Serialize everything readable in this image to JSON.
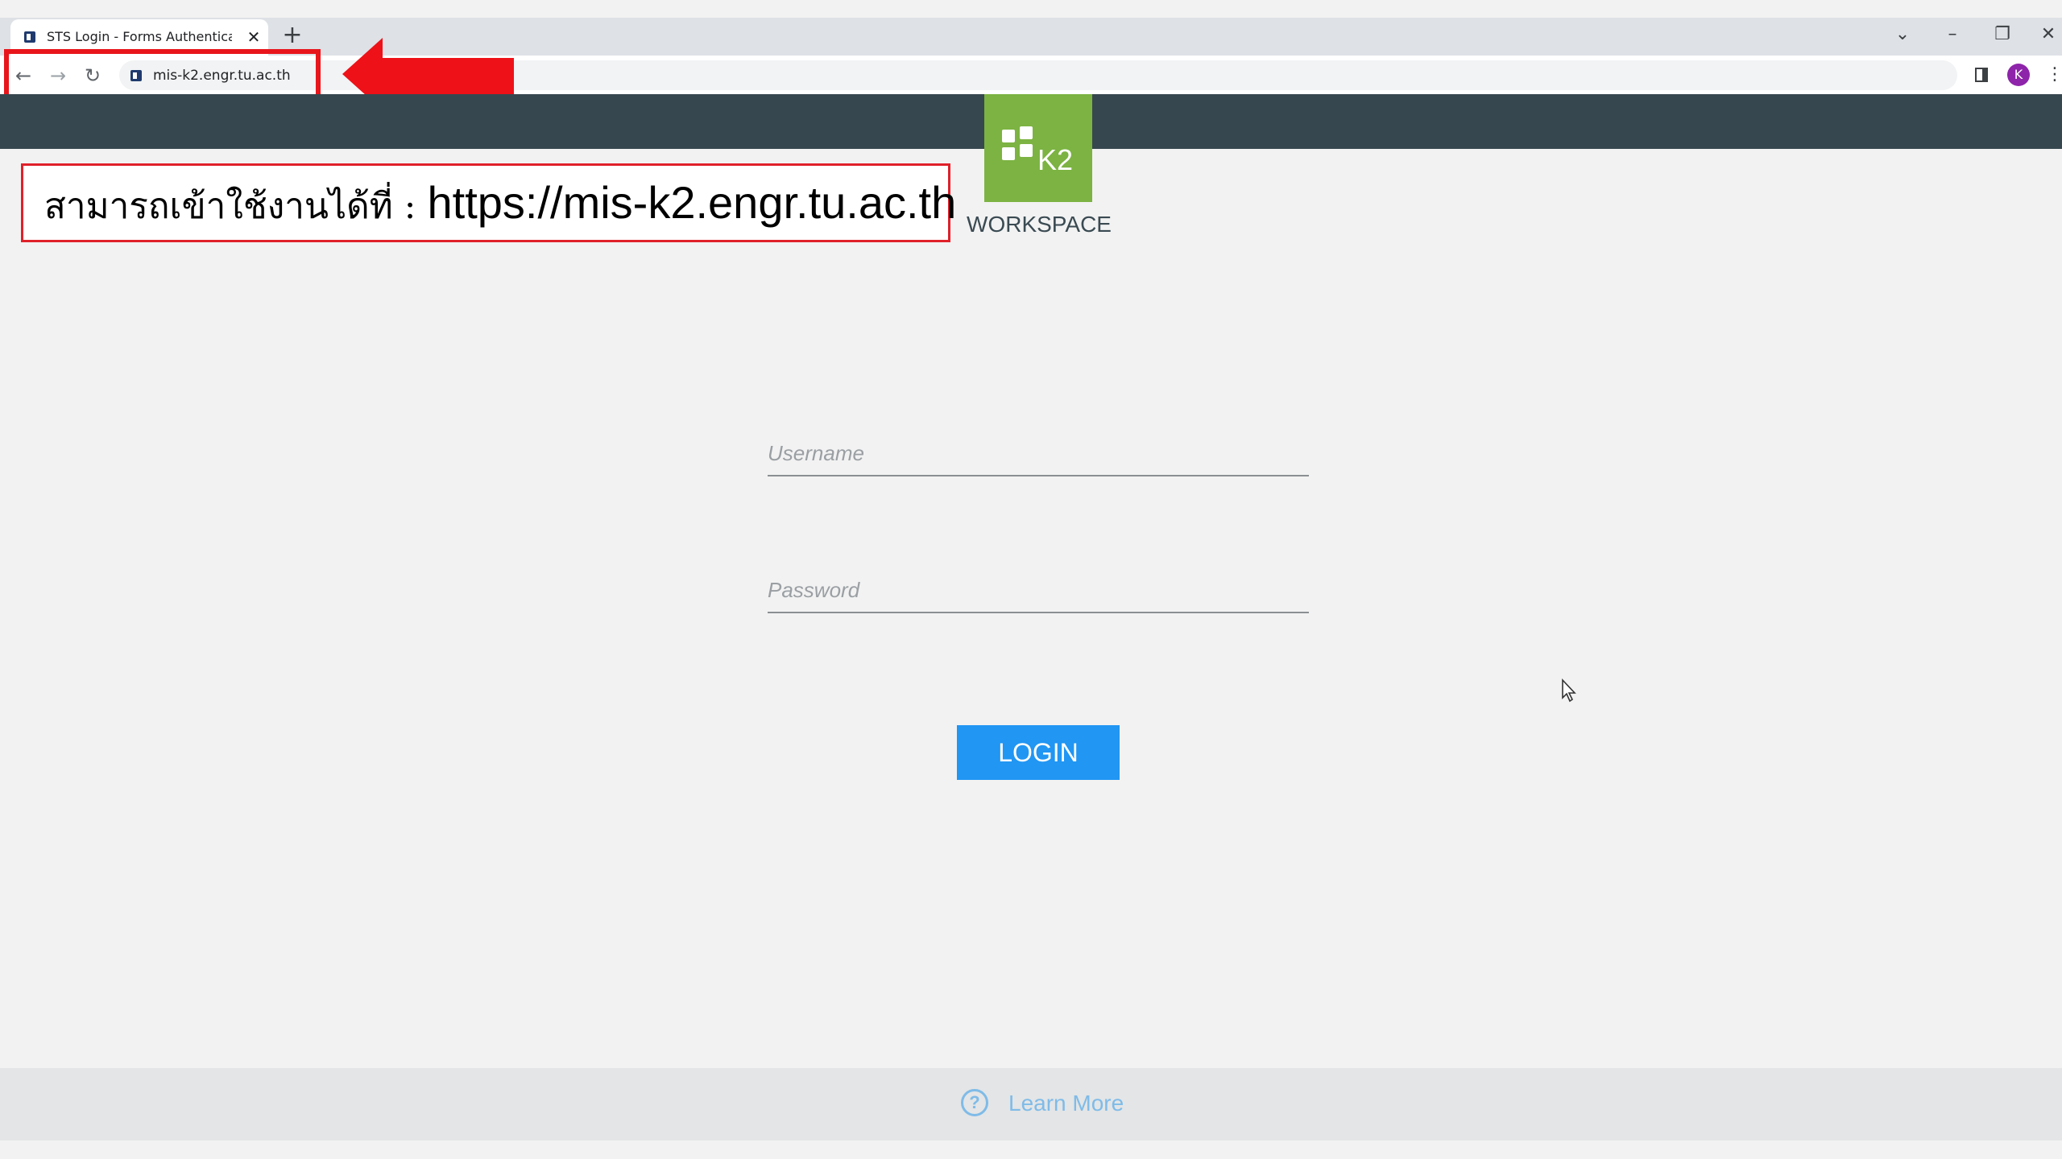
{
  "browser": {
    "tab": {
      "title": "STS Login - Forms Authentication",
      "close_glyph": "✕",
      "favicon": "k2-favicon"
    },
    "new_tab_glyph": "+",
    "window_controls": {
      "tab_search_glyph": "⌄",
      "minimize_glyph": "–",
      "restore_glyph": "❐",
      "close_glyph": "✕"
    },
    "nav": {
      "back_glyph": "←",
      "forward_glyph": "→",
      "reload_glyph": "↻"
    },
    "address_bar": {
      "url": "mis-k2.engr.tu.ac.th"
    },
    "profile_initial": "K",
    "menu_glyph": "⋮"
  },
  "annotation": {
    "thai_text": "สามารถเข้าใช้งานได้ที่ : ",
    "url_text": "https://mis-k2.engr.tu.ac.th",
    "highlight_color": "#e8151b"
  },
  "header": {
    "logo_text": "K2",
    "workspace_label": "WORKSPACE",
    "header_color": "#37474f",
    "logo_color": "#7cb342"
  },
  "login_form": {
    "username_placeholder": "Username",
    "username_value": "",
    "password_placeholder": "Password",
    "password_value": "",
    "login_label": "LOGIN",
    "button_color": "#2196f3"
  },
  "footer": {
    "help_glyph": "?",
    "learn_more_label": "Learn More",
    "link_color": "#7fbbe8"
  }
}
